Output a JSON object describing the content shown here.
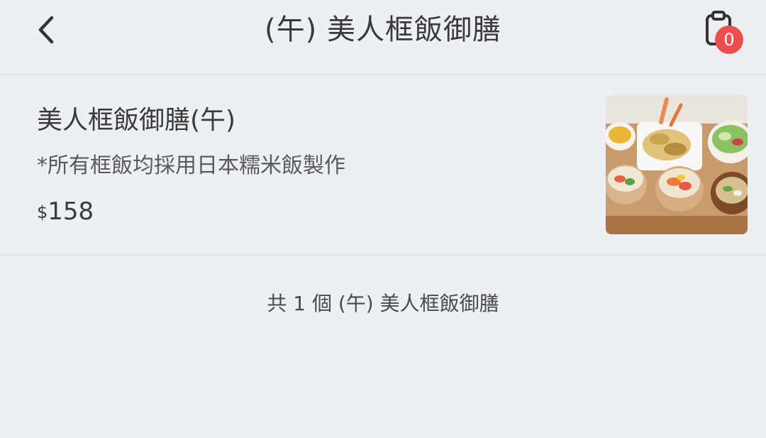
{
  "header": {
    "back_icon": "chevron-left-icon",
    "title": "(午) 美人框飯御膳",
    "cart_icon": "clipboard-icon",
    "cart_count": "0"
  },
  "item": {
    "name": "美人框飯御膳(午)",
    "description": "*所有框飯均採用日本糯米飯製作",
    "price_symbol": "$",
    "price": "158",
    "image": "bento-meal-photo"
  },
  "summary": "共 1 個 (午) 美人框飯御膳",
  "colors": {
    "background": "#eceff3",
    "badge": "#ec4d4d",
    "text": "#3a3a3a"
  }
}
